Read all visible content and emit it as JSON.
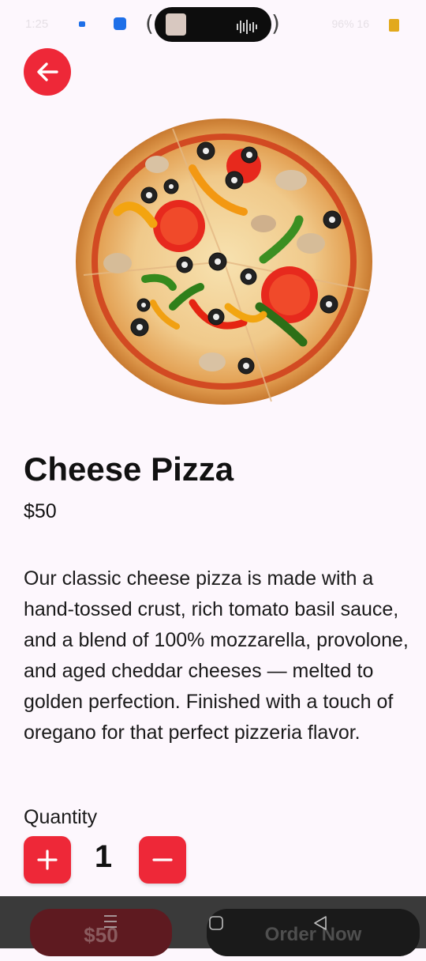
{
  "status_bar": {
    "time": "1:25",
    "right_text": "96% 16"
  },
  "icons": {
    "back": "arrow-left-icon",
    "increment": "plus-icon",
    "decrement": "minus-icon",
    "nav_menu": "menu-lines-icon",
    "nav_home": "square-home-icon",
    "nav_back": "triangle-back-icon"
  },
  "colors": {
    "accent": "#ee2838",
    "background": "#fdf7fd"
  },
  "product": {
    "name": "Cheese Pizza",
    "price": "$50",
    "description": "Our classic cheese pizza is made with a hand-tossed crust, rich tomato basil sauce, and a blend of 100% mozzarella, provolone, and aged cheddar cheeses — melted to golden perfection. Finished with a touch of oregano for that perfect pizzeria flavor."
  },
  "quantity": {
    "label": "Quantity",
    "value": "1"
  },
  "bottom_bar": {
    "total_label": "$50",
    "order_label": "Order Now"
  }
}
